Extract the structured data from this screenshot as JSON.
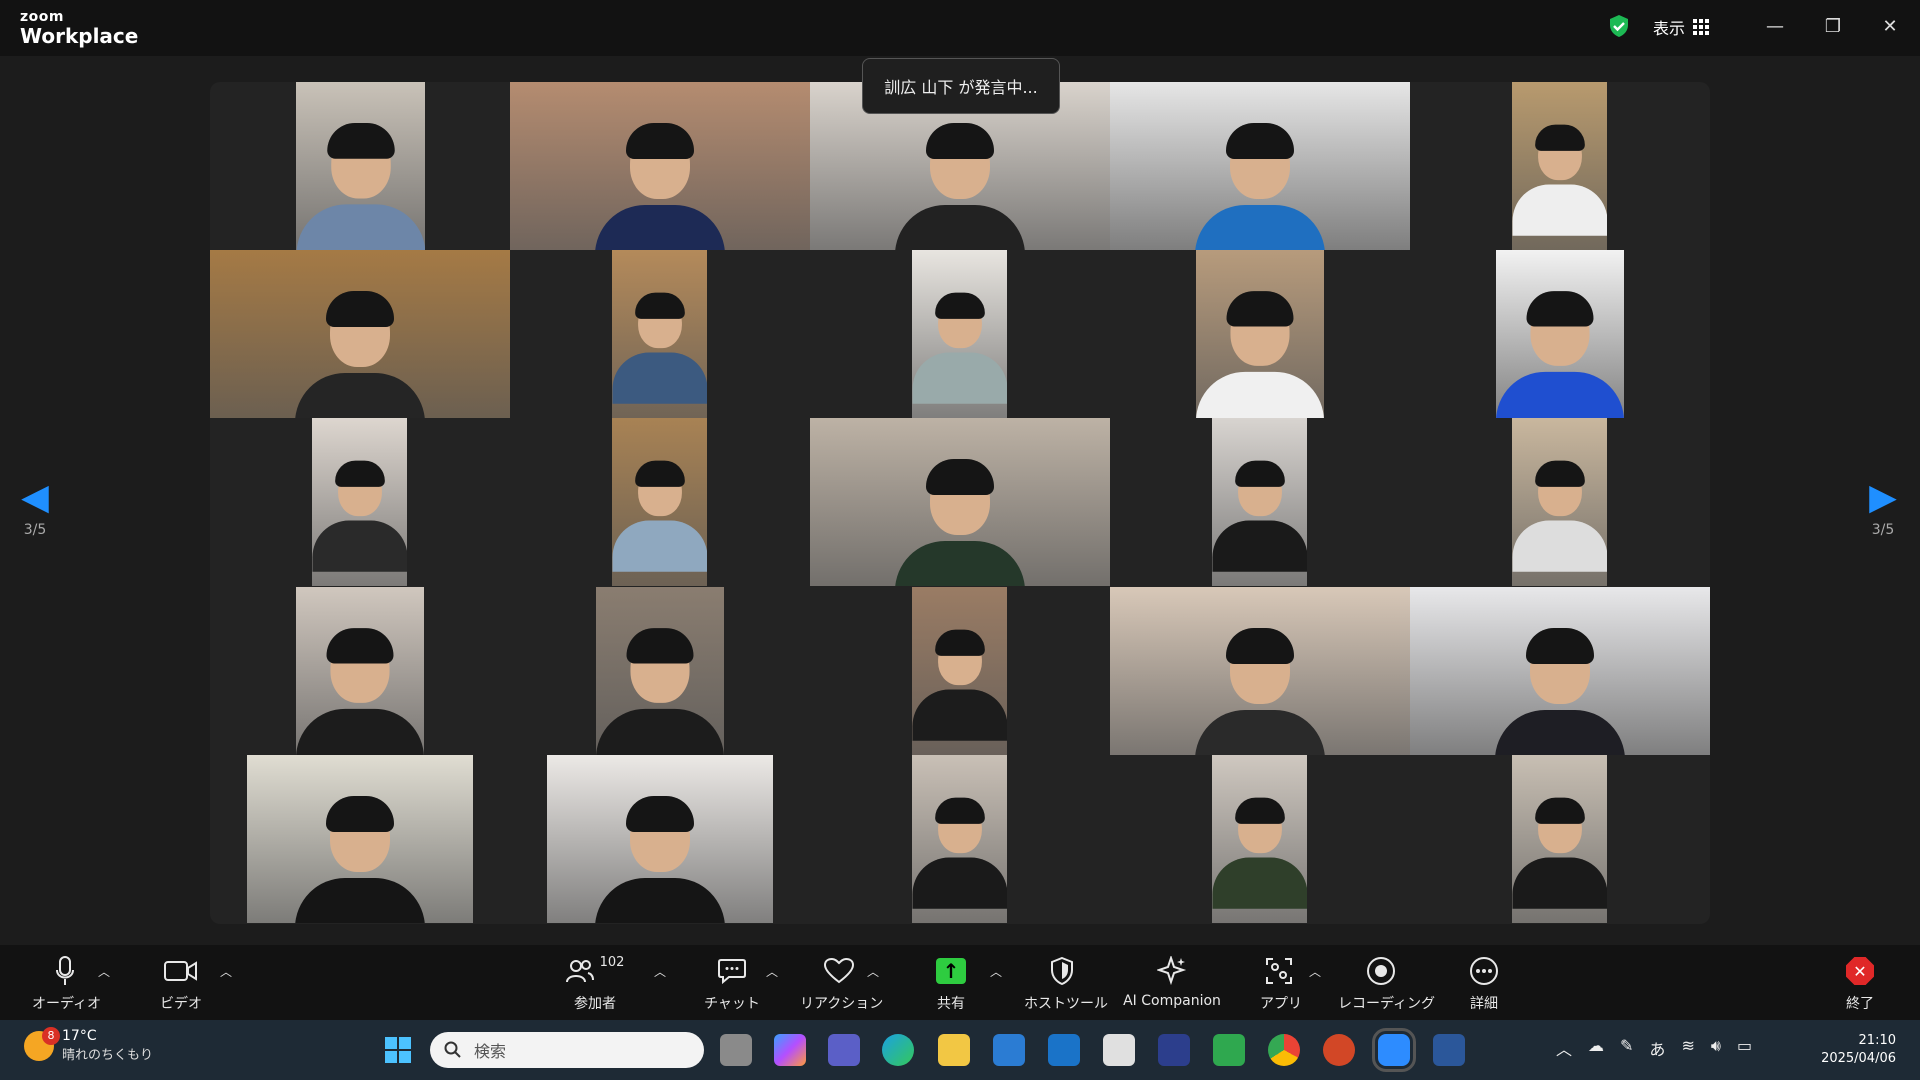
{
  "titlebar": {
    "brand_small": "zoom",
    "brand_large": "Workplace",
    "view_label": "表示",
    "minimize_glyph": "—",
    "maximize_glyph": "❐",
    "close_glyph": "✕"
  },
  "toast": {
    "speaking_text": "訓広 山下 が発言中..."
  },
  "pagination": {
    "left_label": "3/5",
    "right_label": "3/5"
  },
  "toolbar": {
    "audio": "オーディオ",
    "video": "ビデオ",
    "participants": "参加者",
    "participants_count": "102",
    "chat": "チャット",
    "reactions": "リアクション",
    "share": "共有",
    "host_tools": "ホストツール",
    "ai_companion": "AI Companion",
    "apps": "アプリ",
    "recording": "レコーディング",
    "more": "詳細",
    "end": "終了"
  },
  "taskbar": {
    "weather_badge": "8",
    "temperature": "17°C",
    "weather_desc": "晴れのちくもり",
    "search_placeholder": "検索",
    "ime_indicator": "あ",
    "time": "21:10",
    "date": "2025/04/06"
  },
  "colors": {
    "accent_blue": "#1f8fff",
    "share_green": "#2ecc40",
    "end_red": "#e02828",
    "shield_green": "#1db954"
  },
  "icons": [
    "microphone-icon",
    "camera-icon",
    "participants-icon",
    "chat-icon",
    "heart-icon",
    "share-arrow-icon",
    "shield-icon",
    "sparkle-icon",
    "apps-icon",
    "record-icon",
    "more-icon",
    "end-icon"
  ]
}
